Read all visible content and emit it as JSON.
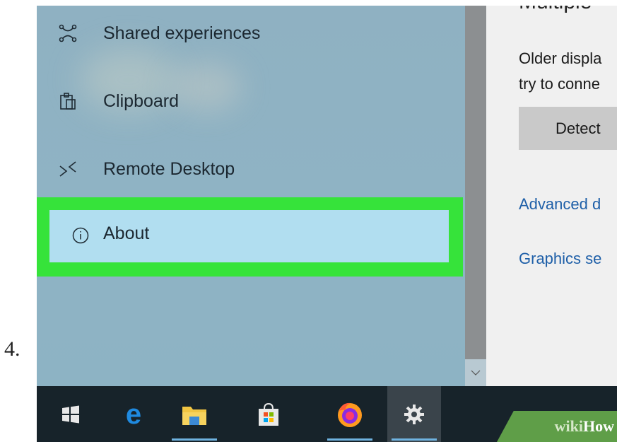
{
  "step": {
    "number": "4."
  },
  "sidebar": {
    "items": [
      {
        "label": "Shared experiences",
        "icon": "shared-experiences-icon"
      },
      {
        "label": "Clipboard",
        "icon": "clipboard-icon"
      },
      {
        "label": "Remote Desktop",
        "icon": "remote-desktop-icon"
      },
      {
        "label": "About",
        "icon": "info-icon",
        "selected": true
      }
    ]
  },
  "content": {
    "heading": "Multiple",
    "description_line1": "Older displa",
    "description_line2": "try to conne",
    "detect_button": "Detect",
    "link_advanced": "Advanced d",
    "link_graphics": "Graphics se"
  },
  "taskbar": {
    "items": [
      {
        "name": "windows-start-icon"
      },
      {
        "name": "edge-icon"
      },
      {
        "name": "file-explorer-icon"
      },
      {
        "name": "store-icon"
      },
      {
        "name": "firefox-icon"
      },
      {
        "name": "settings-gear-icon",
        "active": true
      }
    ]
  },
  "watermark": {
    "part1": "wiki",
    "part2": "How"
  },
  "colors": {
    "highlight": "#36e33a",
    "selected_background": "#b1def0",
    "sidebar_background": "#8fb3c4",
    "taskbar": "#17232a",
    "link": "#1e5fa8"
  }
}
